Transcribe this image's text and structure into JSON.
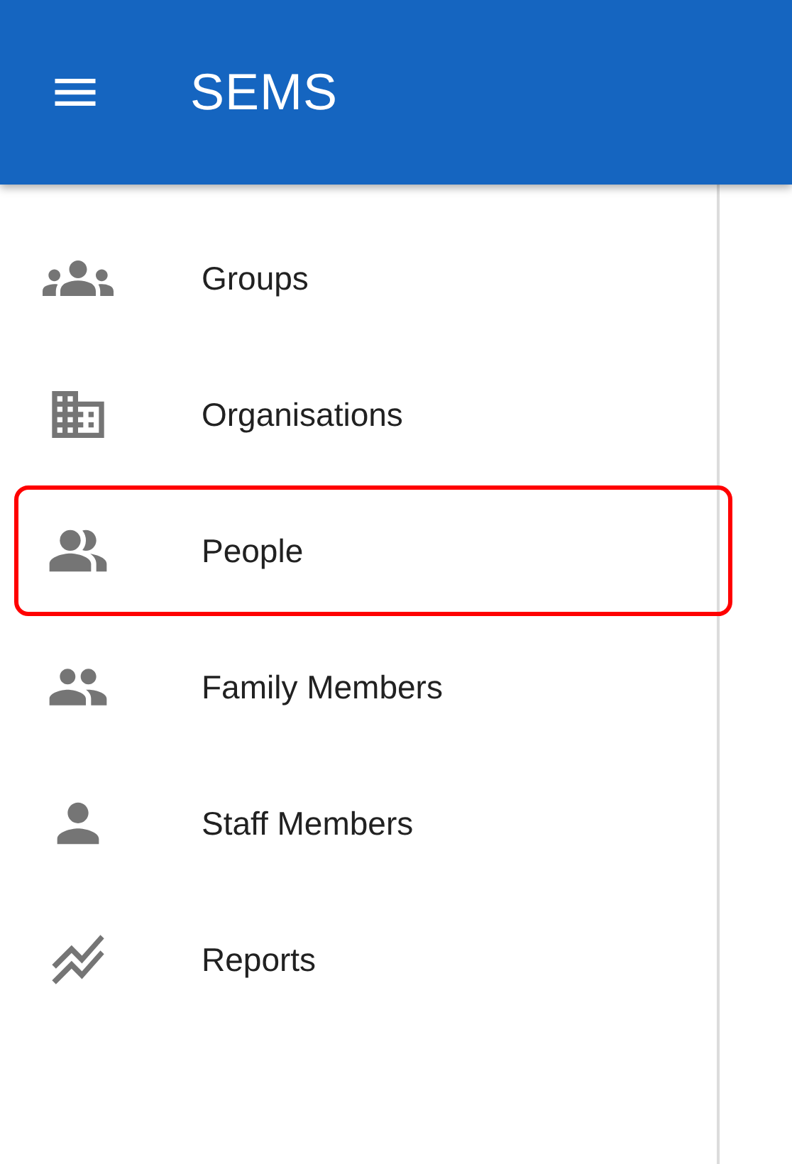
{
  "app_bar": {
    "title": "SEMS"
  },
  "sidebar": {
    "items": [
      {
        "label": "Groups",
        "highlighted": false
      },
      {
        "label": "Organisations",
        "highlighted": false
      },
      {
        "label": "People",
        "highlighted": true
      },
      {
        "label": "Family Members",
        "highlighted": false
      },
      {
        "label": "Staff Members",
        "highlighted": false
      },
      {
        "label": "Reports",
        "highlighted": false
      }
    ]
  }
}
